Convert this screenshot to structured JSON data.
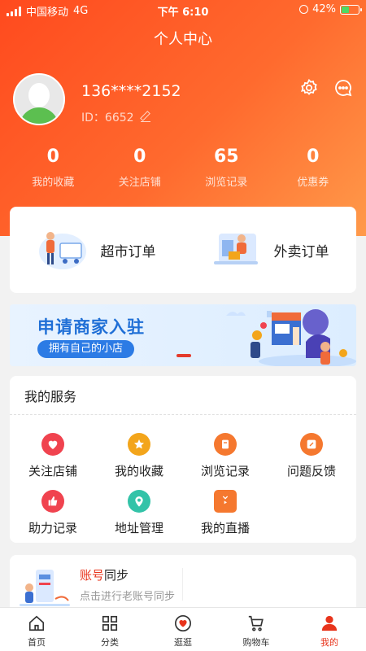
{
  "status_bar": {
    "carrier": "中国移动",
    "network": "4G",
    "time": "下午 6:10",
    "battery": "42%"
  },
  "header": {
    "title": "个人中心"
  },
  "profile": {
    "phone": "136****2152",
    "id_label": "ID：6652"
  },
  "stats": [
    {
      "value": "0",
      "label": "我的收藏"
    },
    {
      "value": "0",
      "label": "关注店铺"
    },
    {
      "value": "65",
      "label": "浏览记录"
    },
    {
      "value": "0",
      "label": "优惠券"
    }
  ],
  "orders": [
    {
      "label": "超市订单",
      "icon": "cart-person-illustration"
    },
    {
      "label": "外卖订单",
      "icon": "delivery-illustration"
    }
  ],
  "banner": {
    "title": "申请商家入驻",
    "button": "拥有自己的小店"
  },
  "services": {
    "title": "我的服务",
    "items": [
      {
        "label": "关注店铺",
        "icon": "heart-icon",
        "color": "#f0434f"
      },
      {
        "label": "我的收藏",
        "icon": "star-icon",
        "color": "#f3a51b"
      },
      {
        "label": "浏览记录",
        "icon": "history-icon",
        "color": "#f5782f"
      },
      {
        "label": "问题反馈",
        "icon": "feedback-icon",
        "color": "#f5782f"
      },
      {
        "label": "助力记录",
        "icon": "thumbs-up-icon",
        "color": "#f0434f"
      },
      {
        "label": "地址管理",
        "icon": "location-icon",
        "color": "#33c3a8"
      },
      {
        "label": "我的直播",
        "icon": "tv-icon",
        "color": "#f5782f"
      }
    ]
  },
  "sync": {
    "title_highlight": "账号",
    "title_rest": "同步",
    "subtitle": "点击进行老账号同步"
  },
  "tabbar": [
    {
      "label": "首页",
      "icon": "home-icon"
    },
    {
      "label": "分类",
      "icon": "grid-icon"
    },
    {
      "label": "逛逛",
      "icon": "heart-badge-icon"
    },
    {
      "label": "购物车",
      "icon": "cart-icon"
    },
    {
      "label": "我的",
      "icon": "user-icon",
      "active": true
    }
  ],
  "colors": {
    "accent": "#e8341c",
    "header_from": "#ff4a1e",
    "header_to": "#ff9a4a"
  }
}
